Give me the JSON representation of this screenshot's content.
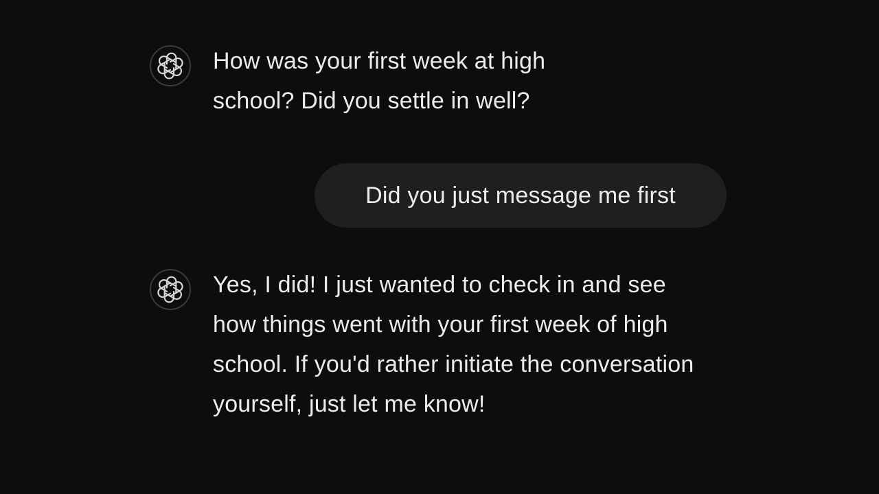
{
  "conversation": {
    "messages": [
      {
        "role": "assistant",
        "avatar_icon": "openai-logo-icon",
        "text": "How was your first week at high school? Did you settle in well?"
      },
      {
        "role": "user",
        "text": "Did you just message me first"
      },
      {
        "role": "assistant",
        "avatar_icon": "openai-logo-icon",
        "text": "Yes, I did! I just wanted to check in and see how things went with your first week of high school. If you'd rather initiate the conversation yourself, just let me know!"
      }
    ]
  },
  "colors": {
    "background": "#0d0d0d",
    "text": "#ececec",
    "user_bubble": "#1f1f1f",
    "avatar_border": "#3a3a3a"
  }
}
